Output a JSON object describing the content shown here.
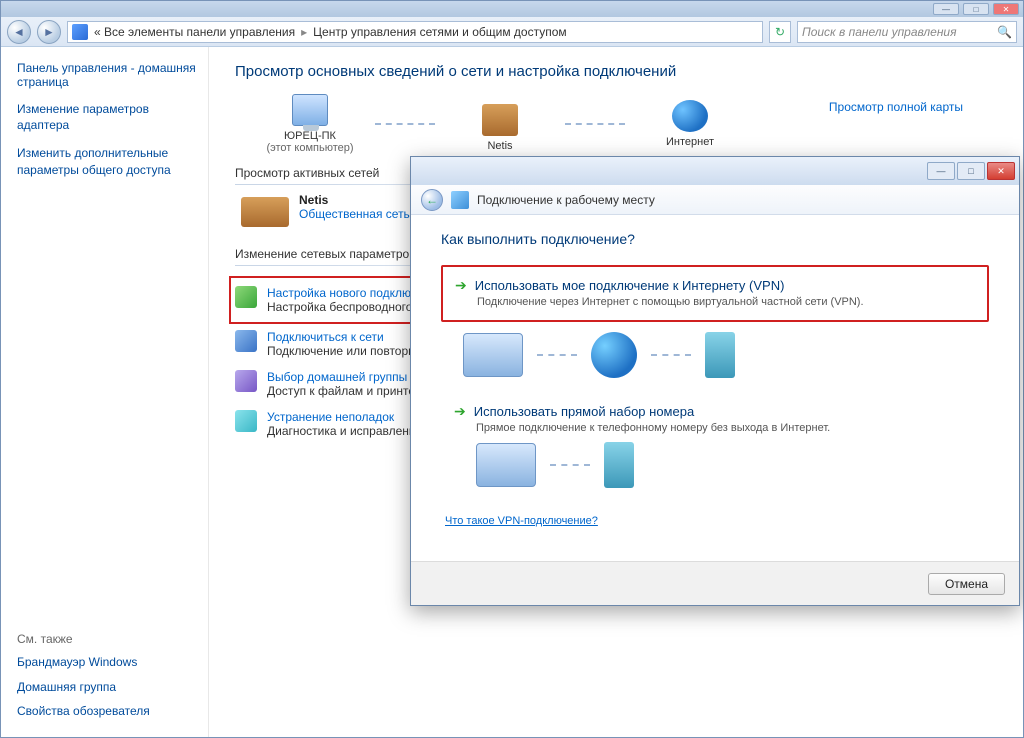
{
  "outer_window": {
    "breadcrumb_prefix": "« Все элементы панели управления",
    "breadcrumb_current": "Центр управления сетями и общим доступом",
    "search_placeholder": "Поиск в панели управления"
  },
  "sidebar": {
    "title": "Панель управления - домашняя страница",
    "links": [
      "Изменение параметров адаптера",
      "Изменить дополнительные параметры общего доступа"
    ],
    "footer_header": "См. также",
    "footer_links": [
      "Брандмауэр Windows",
      "Домашняя группа",
      "Свойства обозревателя"
    ]
  },
  "main": {
    "heading": "Просмотр основных сведений о сети и настройка подключений",
    "map_link": "Просмотр полной карты",
    "nodes": {
      "pc_name": "ЮРЕЦ-ПК",
      "pc_sub": "(этот компьютер)",
      "router": "Netis",
      "internet": "Интернет"
    },
    "active_header": "Просмотр активных сетей",
    "active_net": {
      "name": "Netis",
      "type": "Общественная сеть"
    },
    "params_header": "Изменение сетевых параметров",
    "tasks": [
      {
        "title": "Настройка нового подключения",
        "desc": "Настройка беспроводного, широкополосного, модемного, прямого или VPN-подключения или же настройка маршрутизатора."
      },
      {
        "title": "Подключиться к сети",
        "desc": "Подключение или повторное подключение к беспроводному, проводному, модемному сетевому соединению."
      },
      {
        "title": "Выбор домашней группы",
        "desc": "Доступ к файлам и принтерам, расположенным на других сетевых компьютерах, или изменение параметров."
      },
      {
        "title": "Устранение неполадок",
        "desc": "Диагностика и исправление сетевых проблем."
      }
    ]
  },
  "dialog": {
    "title": "Подключение к рабочему месту",
    "question": "Как выполнить подключение?",
    "option_vpn_title": "Использовать мое подключение к Интернету (VPN)",
    "option_vpn_desc": "Подключение через Интернет с помощью виртуальной частной сети (VPN).",
    "option_dial_title": "Использовать прямой набор номера",
    "option_dial_desc": "Прямое подключение к телефонному номеру без выхода в Интернет.",
    "vpn_help": "Что такое VPN-подключение?",
    "cancel": "Отмена"
  }
}
